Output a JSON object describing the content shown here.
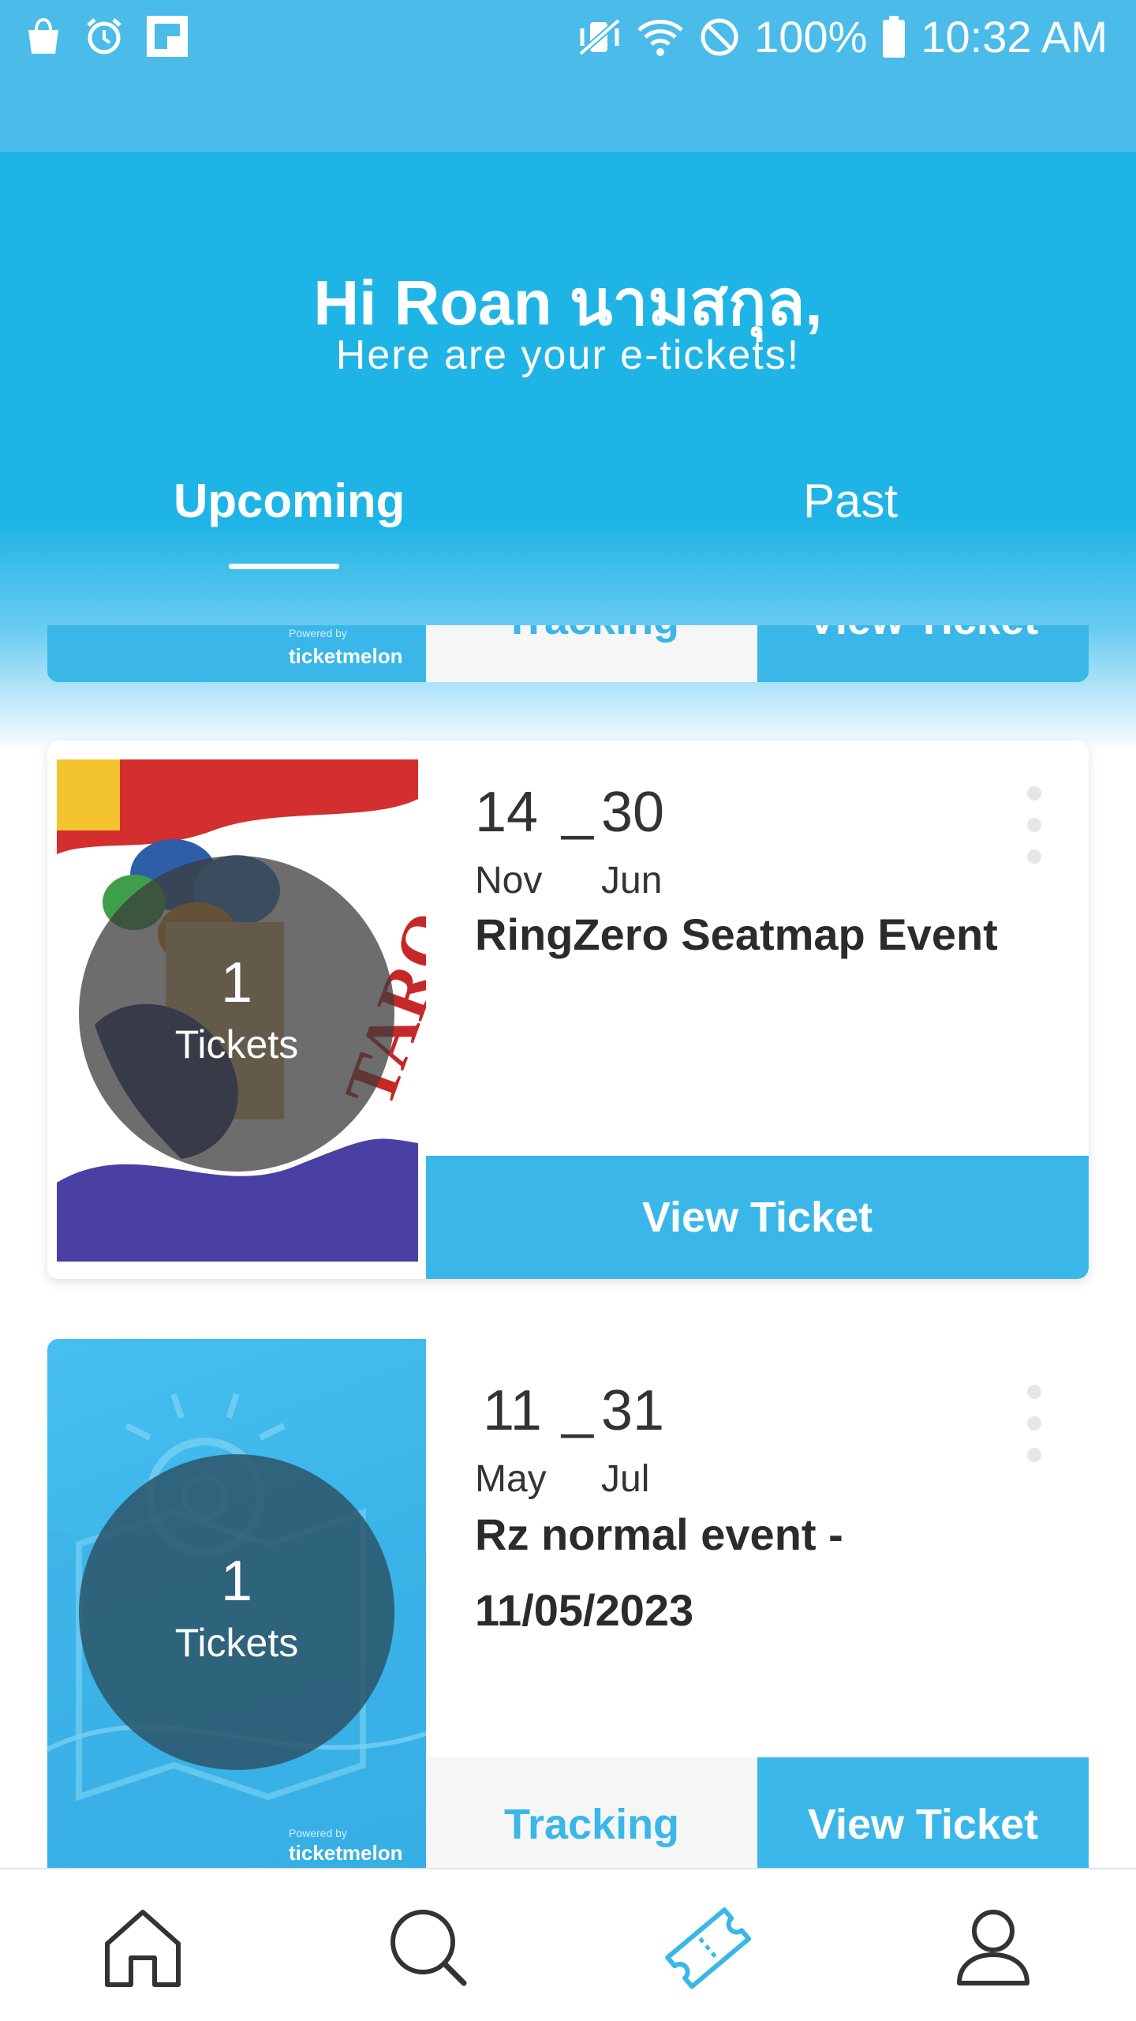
{
  "status_bar": {
    "battery": "100%",
    "time": "10:32 AM",
    "icons_left": [
      "shopping-bag-icon",
      "alarm-icon",
      "flipboard-icon"
    ],
    "icons_right": [
      "vibrate-mute-icon",
      "wifi-icon",
      "blocked-icon",
      "battery-icon"
    ]
  },
  "header": {
    "greeting": "Hi Roan นามสกุล,",
    "subtitle": "Here are your e-tickets!"
  },
  "tabs": [
    {
      "label": "Upcoming",
      "active": true
    },
    {
      "label": "Past",
      "active": false
    }
  ],
  "partial_card": {
    "brand_small": "Powered by",
    "brand": "ticketmelon",
    "tracking_label": "Tracking",
    "view_label": "View Ticket"
  },
  "events": [
    {
      "tickets_count": "1",
      "tickets_label": "Tickets",
      "start_day": "14",
      "start_month": "Nov",
      "end_day": "30",
      "end_month": "Jun",
      "dash": "_",
      "title": "RingZero Seatmap Event",
      "view_label": "View Ticket"
    },
    {
      "tickets_count": "1",
      "tickets_label": "Tickets",
      "start_day": "11",
      "start_month": "May",
      "end_day": "31",
      "end_month": "Jul",
      "dash": "_",
      "title": "Rz normal event - 11/05/2023",
      "tracking_label": "Tracking",
      "view_label": "View Ticket",
      "brand_small": "Powered by",
      "brand": "ticketmelon"
    }
  ],
  "bottom_nav": [
    "home-icon",
    "search-icon",
    "ticket-icon",
    "profile-icon"
  ],
  "colors": {
    "accent": "#3ab7e8",
    "header": "#1fb4e6",
    "dark_text": "#2b2b2b"
  }
}
